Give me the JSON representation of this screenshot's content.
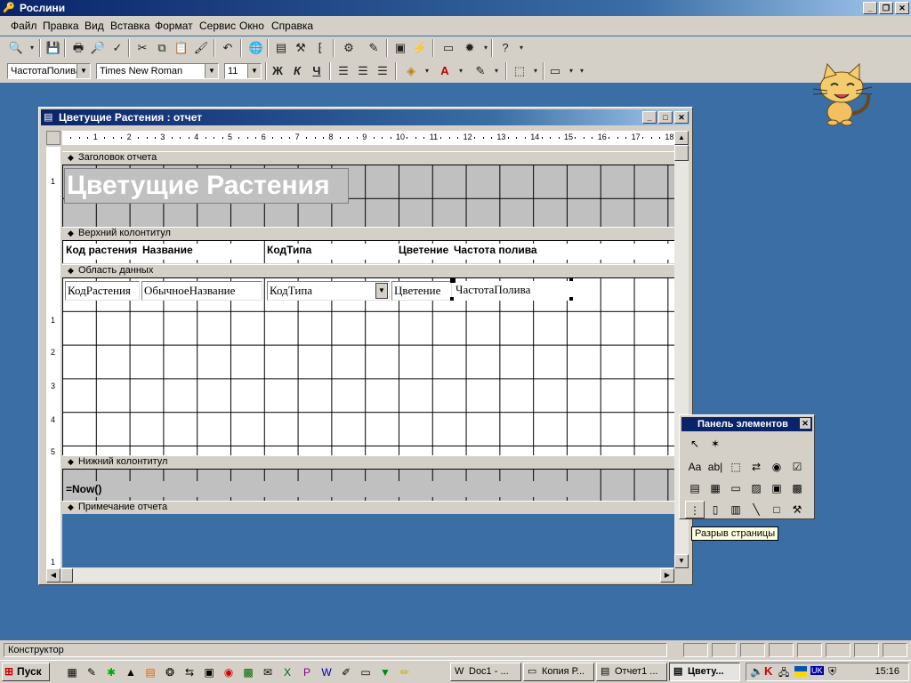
{
  "app": {
    "title": "Рослини"
  },
  "menu": [
    "Файл",
    "Правка",
    "Вид",
    "Вставка",
    "Формат",
    "Сервис",
    "Окно",
    "Справка"
  ],
  "format_bar": {
    "object": "ЧастотаПолива",
    "font": "Times New Roman",
    "size": "11",
    "bold": "Ж",
    "italic": "К",
    "underline": "Ч"
  },
  "window": {
    "title": "Цветущие Растения : отчет"
  },
  "ruler": [
    "1",
    "2",
    "3",
    "4",
    "5",
    "6",
    "7",
    "8",
    "9",
    "10",
    "11",
    "12",
    "13",
    "14",
    "15",
    "16",
    "17",
    "18"
  ],
  "ruler_v": [
    "1",
    "1",
    "2",
    "3",
    "4",
    "5",
    "1"
  ],
  "sections": {
    "report_header": "Заголовок отчета",
    "page_header": "Верхний колонтитул",
    "detail": "Область данных",
    "page_footer": "Нижний колонтитул",
    "report_footer": "Примечание отчета"
  },
  "report_title": "Цветущие Растения",
  "headers": [
    "Код растения",
    "Название",
    "КодТипа",
    "Цветение",
    "Частота полива"
  ],
  "fields": [
    "КодРастения",
    "ОбычноеНазвание",
    "КодТипа",
    "Цветение",
    "ЧастотаПолива"
  ],
  "footer_expr": "=Now()",
  "toolbox": {
    "title": "Панель элементов",
    "tooltip": "Разрыв страницы",
    "tools": [
      {
        "icon": "↖",
        "name": "select-tool-icon"
      },
      {
        "icon": "✶",
        "name": "wizard-tool-icon"
      },
      {
        "icon": "Aa",
        "name": "label-tool-icon"
      },
      {
        "icon": "ab|",
        "name": "textbox-tool-icon"
      },
      {
        "icon": "⬚",
        "name": "option-group-tool-icon"
      },
      {
        "icon": "⇄",
        "name": "toggle-tool-icon"
      },
      {
        "icon": "◉",
        "name": "radio-tool-icon"
      },
      {
        "icon": "☑",
        "name": "checkbox-tool-icon"
      },
      {
        "icon": "▤",
        "name": "combobox-tool-icon"
      },
      {
        "icon": "▦",
        "name": "listbox-tool-icon"
      },
      {
        "icon": "▭",
        "name": "button-tool-icon"
      },
      {
        "icon": "▨",
        "name": "image-tool-icon"
      },
      {
        "icon": "▣",
        "name": "unbound-frame-tool-icon"
      },
      {
        "icon": "▩",
        "name": "bound-frame-tool-icon"
      },
      {
        "icon": "⋮",
        "name": "page-break-tool-icon"
      },
      {
        "icon": "▯",
        "name": "tab-control-tool-icon"
      },
      {
        "icon": "▥",
        "name": "subform-tool-icon"
      },
      {
        "icon": "╲",
        "name": "line-tool-icon"
      },
      {
        "icon": "□",
        "name": "rectangle-tool-icon"
      },
      {
        "icon": "⚒",
        "name": "more-controls-tool-icon"
      }
    ]
  },
  "status": {
    "text": "Конструктор"
  },
  "taskbar": {
    "start": "Пуск",
    "tasks": [
      "Doc1 - ...",
      "Копия Р...",
      "Отчет1 ...",
      "Цвету..."
    ],
    "clock": "15:16",
    "lang": "UK"
  }
}
